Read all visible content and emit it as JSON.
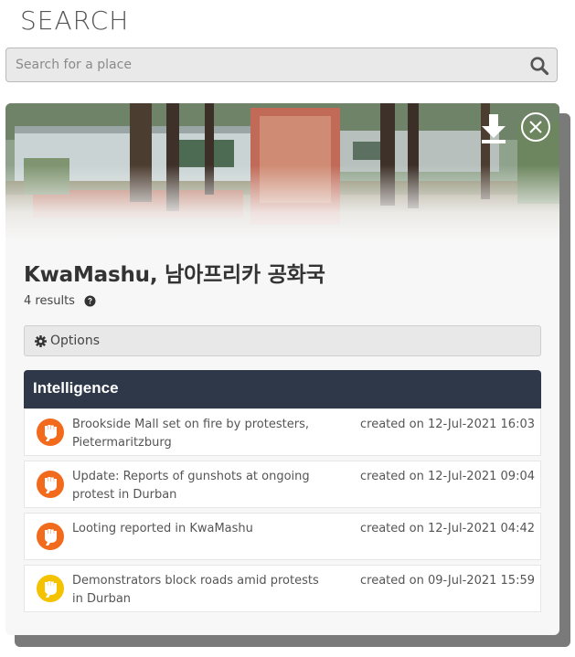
{
  "page": {
    "heading": "SEARCH"
  },
  "search": {
    "placeholder": "Search for a place",
    "value": ""
  },
  "panel": {
    "place_title": "KwaMashu, 남아프리카 공화국",
    "results_text": "4 results",
    "options_label": "Options",
    "section_title": "Intelligence",
    "items": [
      {
        "title": "Brookside Mall set on fire by protesters, Pietermaritzburg",
        "date": "created on 12-Jul-2021 16:03",
        "icon": "raised-fist-icon",
        "color": "#f26a1b"
      },
      {
        "title": "Update: Reports of gunshots at ongoing protest in Durban",
        "date": "created on 12-Jul-2021 09:04",
        "icon": "raised-fist-icon",
        "color": "#f26a1b"
      },
      {
        "title": "Looting reported in KwaMashu",
        "date": "created on 12-Jul-2021 04:42",
        "icon": "raised-fist-icon",
        "color": "#f26a1b"
      },
      {
        "title": "Demonstrators block roads amid protests in Durban",
        "date": "created on 09-Jul-2021 15:59",
        "icon": "raised-fist-icon",
        "color": "#f5c200"
      }
    ]
  },
  "colors": {
    "header_bg": "#2e3848",
    "accent_orange": "#f26a1b",
    "accent_yellow": "#f5c200"
  }
}
